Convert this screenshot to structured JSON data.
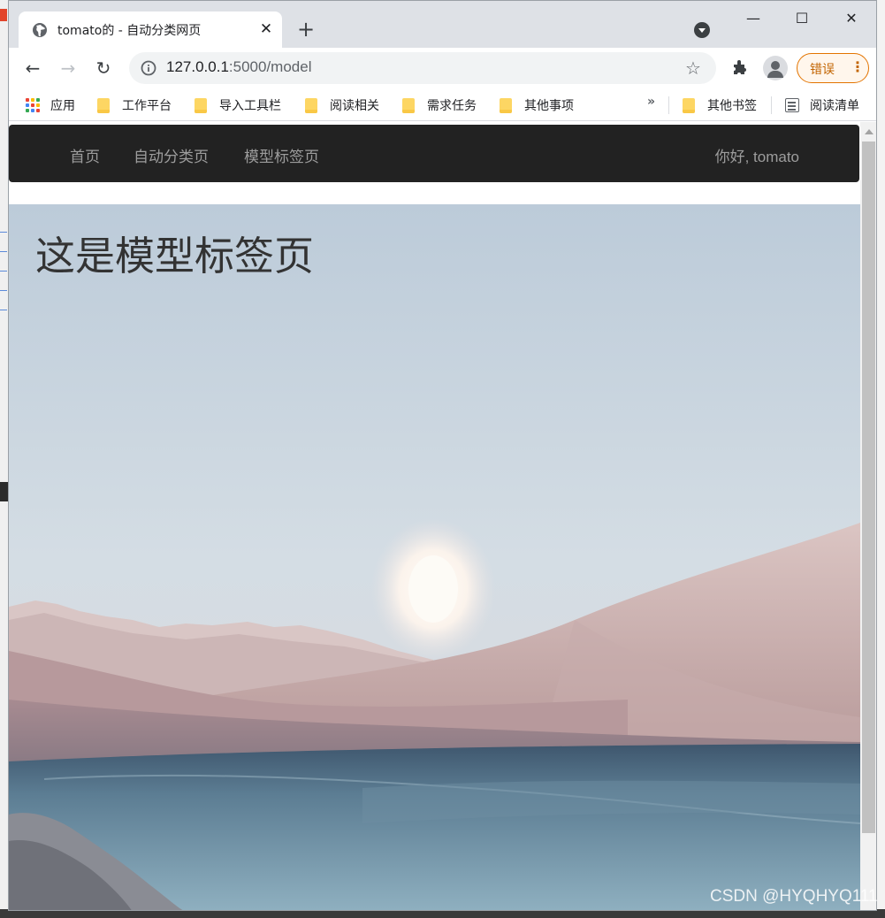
{
  "browser": {
    "tab_title": "tomato的 - 自动分类网页",
    "url_host": "127.0.0.1",
    "url_rest": ":5000/model",
    "error_button_label": "错误",
    "window_controls": {
      "minimize": "—",
      "maximize": "☐",
      "close": "✕"
    }
  },
  "bookmarks": {
    "apps_label": "应用",
    "items": [
      "工作平台",
      "导入工具栏",
      "阅读相关",
      "需求任务",
      "其他事项"
    ],
    "more": "»",
    "other_bookmarks": "其他书签",
    "reading_list": "阅读清单"
  },
  "navbar": {
    "links": [
      "首页",
      "自动分类页",
      "模型标签页"
    ],
    "greeting": "你好, tomato"
  },
  "hero": {
    "title": "这是模型标签页"
  },
  "watermark": "CSDN @HYQHYQ111",
  "colors": {
    "navbar_bg": "#222222",
    "navbar_text": "#9d9d9d",
    "error_accent": "#e37400",
    "folder": "#fdd663"
  }
}
